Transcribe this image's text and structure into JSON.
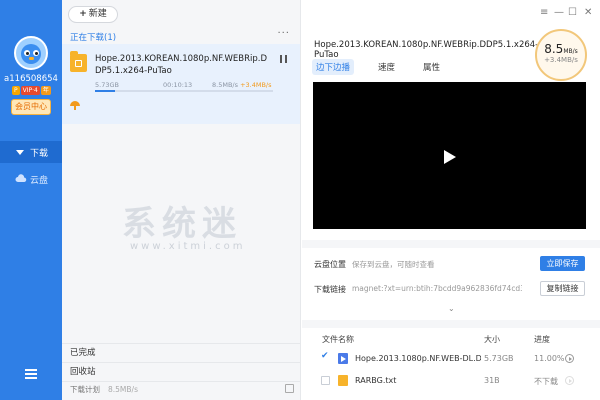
{
  "sidebar": {
    "username": "a116508654",
    "badges": [
      "P",
      "VIP·4",
      "年"
    ],
    "vip_center": "会员中心",
    "nav": [
      {
        "label": "下载",
        "icon": "download-icon",
        "active": true
      },
      {
        "label": "云盘",
        "icon": "cloud-icon",
        "active": false
      }
    ],
    "menu_icon": "hamburger-menu-icon"
  },
  "downloads": {
    "new_button": "新建",
    "section_title": "正在下载(1)",
    "more_label": "···",
    "item": {
      "name": "Hope.2013.KOREAN.1080p.NF.WEBRip.DDP5.1.x264-PuTao",
      "size": "5.73GB",
      "time_left": "00:10:13",
      "speed": "8.5MB/s",
      "boost": "+3.4MB/s",
      "progress": 0.11
    },
    "completed_label": "已完成",
    "recycle_label": "回收站",
    "plan_label": "下载计划",
    "plan_speed": "8.5MB/s"
  },
  "watermark": {
    "text": "系统迷",
    "sub": "www.xitmi.com"
  },
  "detail": {
    "title": "Hope.2013.KOREAN.1080p.NF.WEBRip.DDP5.1.x264-PuTao",
    "speed_main": "8.5",
    "speed_unit": "MB/s",
    "speed_boost": "+3.4MB/s",
    "tabs": [
      "边下边播",
      "速度",
      "属性"
    ],
    "cloud_location_label": "云盘位置",
    "cloud_location_value": "保存到云盘，可随时查看",
    "save_button": "立即保存",
    "link_label": "下载链接",
    "link_value": "magnet:?xt=urn:btih:7bcdd9a962836fd74cd3...",
    "copy_button": "复制链接",
    "expand_icon": "chevron-down-icon",
    "table_headers": [
      "文件名称",
      "大小",
      "进度"
    ],
    "files": [
      {
        "name": "Hope.2013.1080p.NF.WEB-DL.DD...",
        "size": "5.73GB",
        "progress": "11.00%",
        "checked": true,
        "type": "video"
      },
      {
        "name": "RARBG.txt",
        "size": "31B",
        "progress": "不下载",
        "checked": false,
        "type": "txt"
      }
    ]
  },
  "window_controls": [
    "≡",
    "—",
    "☐",
    "✕"
  ]
}
